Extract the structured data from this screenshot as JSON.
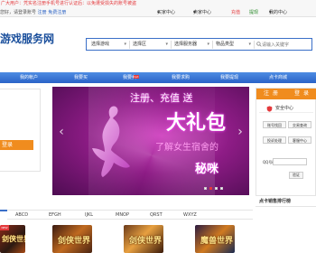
{
  "notice": "广大用户：凭实名注册手机号进行认证后：以免遭受损失的账号被盗",
  "topbar": {
    "left_prefix": "您好，请登录账号",
    "register": "注册",
    "login": "免费注册",
    "links": [
      "买家中心",
      "卖家中心",
      "充值",
      "提现",
      "我的中心"
    ]
  },
  "logo": "游戏服务网",
  "search": {
    "selects": [
      "选择游戏",
      "选择区",
      "选择服务器",
      "物品类型"
    ],
    "placeholder": "请输入关键字"
  },
  "nav": {
    "items": [
      "我的帐户",
      "我要买",
      "我要卖",
      "我要求购",
      "我要提现",
      "点卡商城"
    ],
    "hot_badge": "hot"
  },
  "left_panel": {
    "button": "登录"
  },
  "banner": {
    "line1": "注册、充值 送",
    "line2": "大礼包",
    "line3": "了解女生宿舍的",
    "line4": "秘咪",
    "prev": "‹",
    "next": "›",
    "slides": 4,
    "active_slide": 2
  },
  "sidebar": {
    "tabs": [
      "注",
      "册",
      "登",
      "录"
    ],
    "safety": "安全中心",
    "buttons": [
      "账号找回",
      "交易查询",
      "投诉处理",
      "客服中心"
    ],
    "qq_label": "QQ号码：",
    "verify": "验证"
  },
  "rank_title": "点卡销售排行榜",
  "alphabet": [
    "ABCD",
    "EFGH",
    "IJKL",
    "MNOP",
    "QRST",
    "WXYZ"
  ],
  "games": [
    {
      "title": "剑侠世界",
      "new": "NEW"
    },
    {
      "title": "剑侠世界",
      "new": ""
    },
    {
      "title": "剑侠世界",
      "new": ""
    },
    {
      "title": "魔兽世界",
      "new": ""
    }
  ],
  "colors": {
    "accent": "#2a63c7",
    "orange": "#f08c1e",
    "red": "#e4393c",
    "banner": "#8e1c86"
  }
}
